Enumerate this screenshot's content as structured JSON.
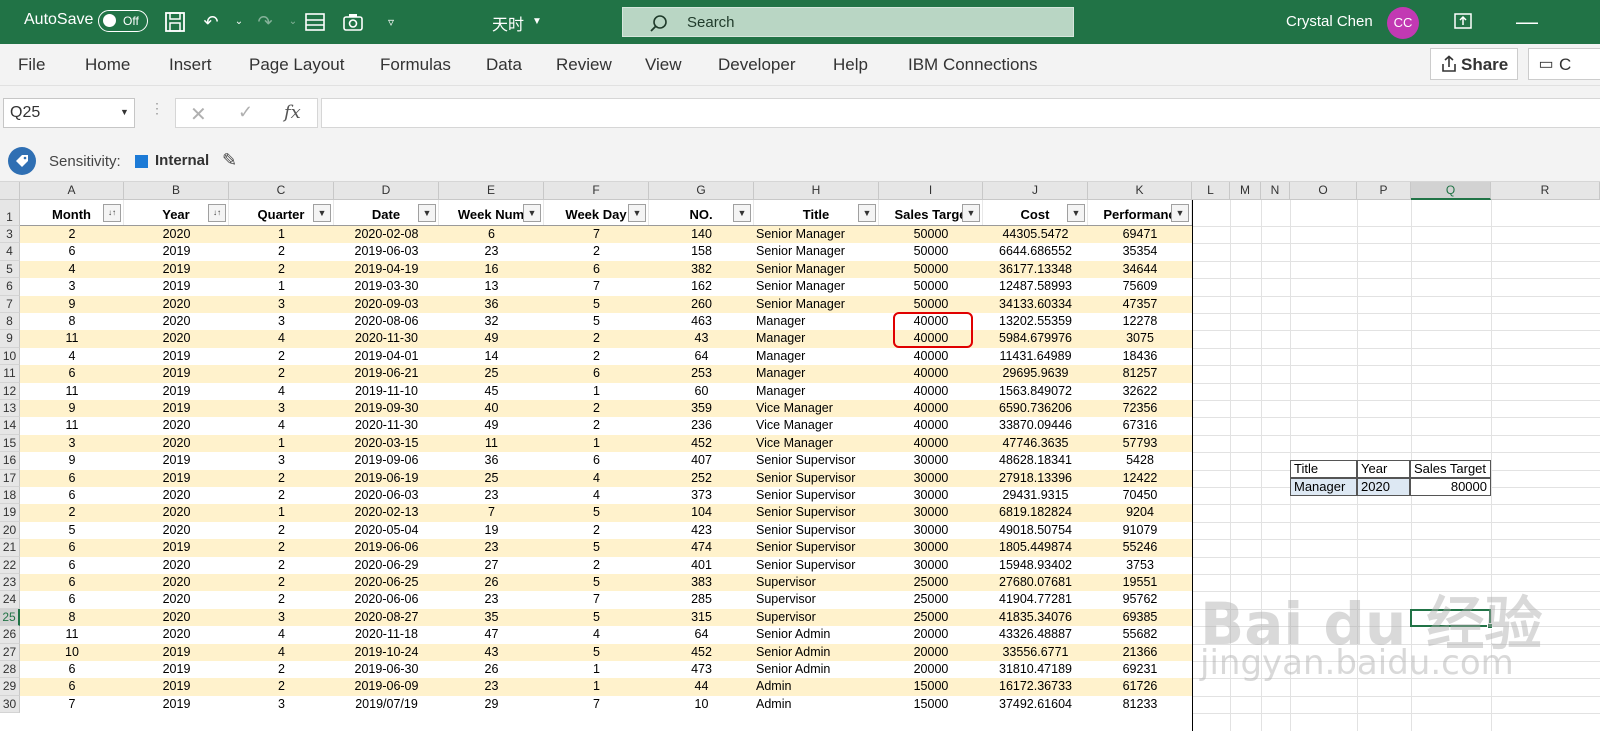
{
  "titlebar": {
    "autosave_label": "AutoSave",
    "autosave_state": "Off",
    "doc_name": "天时",
    "search_placeholder": "Search",
    "user_name": "Crystal Chen",
    "user_initials": "CC"
  },
  "ribbon": {
    "tabs": [
      "File",
      "Home",
      "Insert",
      "Page Layout",
      "Formulas",
      "Data",
      "Review",
      "View",
      "Developer",
      "Help",
      "IBM Connections"
    ],
    "share_label": "Share",
    "comments_label": "C"
  },
  "formula_bar": {
    "name_box": "Q25",
    "cancel_symbol": "✕",
    "enter_symbol": "✓",
    "fx_label": "fx",
    "content": ""
  },
  "sensitivity": {
    "label": "Sensitivity:",
    "value": "Internal"
  },
  "columns": [
    "A",
    "B",
    "C",
    "D",
    "E",
    "F",
    "G",
    "H",
    "I",
    "J",
    "K",
    "L",
    "M",
    "N",
    "O",
    "P",
    "Q",
    "R"
  ],
  "headers": [
    "Month",
    "Year",
    "Quarter",
    "Date",
    "Week Num",
    "Week Day",
    "NO.",
    "Title",
    "Sales Targe",
    "Cost",
    "Performanc"
  ],
  "row_numbers": [
    1,
    3,
    4,
    5,
    6,
    7,
    8,
    9,
    10,
    11,
    12,
    13,
    14,
    15,
    16,
    17,
    18,
    19,
    20,
    21,
    22,
    23,
    24,
    25,
    26,
    27,
    28,
    29,
    30
  ],
  "rows": [
    [
      "2",
      "2020",
      "1",
      "2020-02-08",
      "6",
      "7",
      "140",
      "Senior Manager",
      "50000",
      "44305.5472",
      "69471"
    ],
    [
      "6",
      "2019",
      "2",
      "2019-06-03",
      "23",
      "2",
      "158",
      "Senior Manager",
      "50000",
      "6644.686552",
      "35354"
    ],
    [
      "4",
      "2019",
      "2",
      "2019-04-19",
      "16",
      "6",
      "382",
      "Senior Manager",
      "50000",
      "36177.13348",
      "34644"
    ],
    [
      "3",
      "2019",
      "1",
      "2019-03-30",
      "13",
      "7",
      "162",
      "Senior Manager",
      "50000",
      "12487.58993",
      "75609"
    ],
    [
      "9",
      "2020",
      "3",
      "2020-09-03",
      "36",
      "5",
      "260",
      "Senior Manager",
      "50000",
      "34133.60334",
      "47357"
    ],
    [
      "8",
      "2020",
      "3",
      "2020-08-06",
      "32",
      "5",
      "463",
      "Manager",
      "40000",
      "13202.55359",
      "12278"
    ],
    [
      "11",
      "2020",
      "4",
      "2020-11-30",
      "49",
      "2",
      "43",
      "Manager",
      "40000",
      "5984.679976",
      "3075"
    ],
    [
      "4",
      "2019",
      "2",
      "2019-04-01",
      "14",
      "2",
      "64",
      "Manager",
      "40000",
      "11431.64989",
      "18436"
    ],
    [
      "6",
      "2019",
      "2",
      "2019-06-21",
      "25",
      "6",
      "253",
      "Manager",
      "40000",
      "29695.9639",
      "81257"
    ],
    [
      "11",
      "2019",
      "4",
      "2019-11-10",
      "45",
      "1",
      "60",
      "Manager",
      "40000",
      "1563.849072",
      "32622"
    ],
    [
      "9",
      "2019",
      "3",
      "2019-09-30",
      "40",
      "2",
      "359",
      "Vice Manager",
      "40000",
      "6590.736206",
      "72356"
    ],
    [
      "11",
      "2020",
      "4",
      "2020-11-30",
      "49",
      "2",
      "236",
      "Vice Manager",
      "40000",
      "33870.09446",
      "67316"
    ],
    [
      "3",
      "2020",
      "1",
      "2020-03-15",
      "11",
      "1",
      "452",
      "Vice Manager",
      "40000",
      "47746.3635",
      "57793"
    ],
    [
      "9",
      "2019",
      "3",
      "2019-09-06",
      "36",
      "6",
      "407",
      "Senior Supervisor",
      "30000",
      "48628.18341",
      "5428"
    ],
    [
      "6",
      "2019",
      "2",
      "2019-06-19",
      "25",
      "4",
      "252",
      "Senior Supervisor",
      "30000",
      "27918.13396",
      "12422"
    ],
    [
      "6",
      "2020",
      "2",
      "2020-06-03",
      "23",
      "4",
      "373",
      "Senior Supervisor",
      "30000",
      "29431.9315",
      "70450"
    ],
    [
      "2",
      "2020",
      "1",
      "2020-02-13",
      "7",
      "5",
      "104",
      "Senior Supervisor",
      "30000",
      "6819.182824",
      "9204"
    ],
    [
      "5",
      "2020",
      "2",
      "2020-05-04",
      "19",
      "2",
      "423",
      "Senior Supervisor",
      "30000",
      "49018.50754",
      "91079"
    ],
    [
      "6",
      "2019",
      "2",
      "2019-06-06",
      "23",
      "5",
      "474",
      "Senior Supervisor",
      "30000",
      "1805.449874",
      "55246"
    ],
    [
      "6",
      "2020",
      "2",
      "2020-06-29",
      "27",
      "2",
      "401",
      "Senior Supervisor",
      "30000",
      "15948.93402",
      "3753"
    ],
    [
      "6",
      "2020",
      "2",
      "2020-06-25",
      "26",
      "5",
      "383",
      "Supervisor",
      "25000",
      "27680.07681",
      "19551"
    ],
    [
      "6",
      "2020",
      "2",
      "2020-06-06",
      "23",
      "7",
      "285",
      "Supervisor",
      "25000",
      "41904.77281",
      "95762"
    ],
    [
      "8",
      "2020",
      "3",
      "2020-08-27",
      "35",
      "5",
      "315",
      "Supervisor",
      "25000",
      "41835.34076",
      "69385"
    ],
    [
      "11",
      "2020",
      "4",
      "2020-11-18",
      "47",
      "4",
      "64",
      "Senior Admin",
      "20000",
      "43326.48887",
      "55682"
    ],
    [
      "10",
      "2019",
      "4",
      "2019-10-24",
      "43",
      "5",
      "452",
      "Senior Admin",
      "20000",
      "33556.6771",
      "21366"
    ],
    [
      "6",
      "2019",
      "2",
      "2019-06-30",
      "26",
      "1",
      "473",
      "Senior Admin",
      "20000",
      "31810.47189",
      "69231"
    ],
    [
      "6",
      "2019",
      "2",
      "2019-06-09",
      "23",
      "1",
      "44",
      "Admin",
      "15000",
      "16172.36733",
      "61726"
    ],
    [
      "7",
      "2019",
      "3",
      "2019/07/19",
      "29",
      "7",
      "10",
      "Admin",
      "15000",
      "37492.61604",
      "81233"
    ]
  ],
  "criteria": {
    "headers": [
      "Title",
      "Year",
      "Sales Target"
    ],
    "values": [
      "Manager",
      "2020",
      "80000"
    ]
  },
  "watermark": {
    "line1": "Bai du 经验",
    "line2": "jingyan.baidu.com"
  },
  "colors": {
    "accent": "#217346",
    "band": "#fff2cc",
    "highlight": "#e00000"
  }
}
